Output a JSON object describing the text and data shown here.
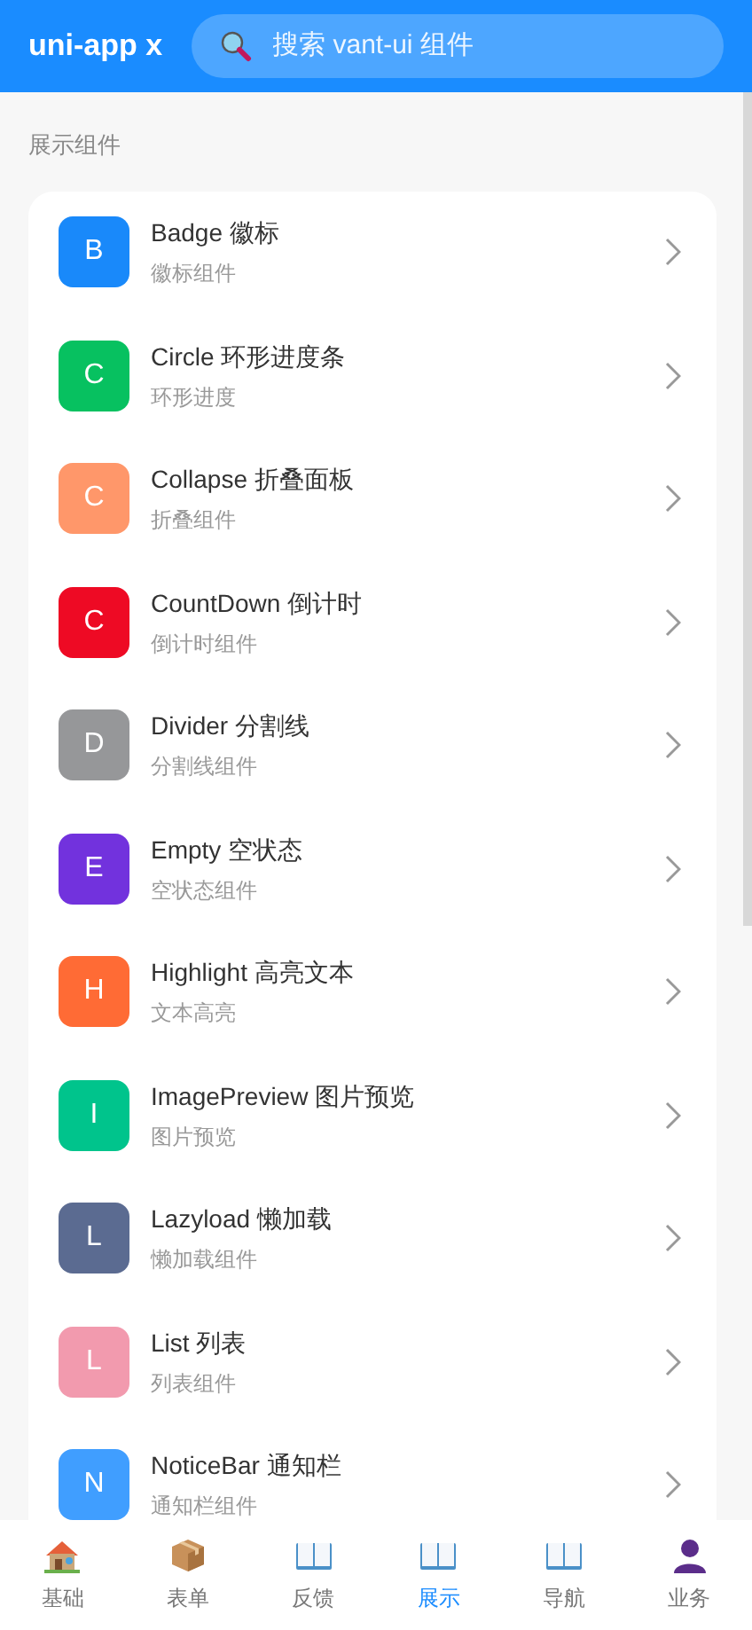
{
  "header": {
    "title": "uni-app x",
    "search": {
      "placeholder": "搜索 vant-ui 组件"
    }
  },
  "section": {
    "title": "展示组件"
  },
  "items": [
    {
      "letter": "B",
      "title": "Badge 徽标",
      "subtitle": "徽标组件",
      "color": "#1989fa"
    },
    {
      "letter": "C",
      "title": "Circle 环形进度条",
      "subtitle": "环形进度",
      "color": "#07c160"
    },
    {
      "letter": "C",
      "title": "Collapse 折叠面板",
      "subtitle": "折叠组件",
      "color": "#ff976a"
    },
    {
      "letter": "C",
      "title": "CountDown 倒计时",
      "subtitle": "倒计时组件",
      "color": "#ee0a24"
    },
    {
      "letter": "D",
      "title": "Divider 分割线",
      "subtitle": "分割线组件",
      "color": "#969799"
    },
    {
      "letter": "E",
      "title": "Empty 空状态",
      "subtitle": "空状态组件",
      "color": "#7232dd"
    },
    {
      "letter": "H",
      "title": "Highlight 高亮文本",
      "subtitle": "文本高亮",
      "color": "#ff6b35"
    },
    {
      "letter": "I",
      "title": "ImagePreview 图片预览",
      "subtitle": "图片预览",
      "color": "#00c48c"
    },
    {
      "letter": "L",
      "title": "Lazyload 懒加载",
      "subtitle": "懒加载组件",
      "color": "#5b6b91"
    },
    {
      "letter": "L",
      "title": "List 列表",
      "subtitle": "列表组件",
      "color": "#f29aae"
    },
    {
      "letter": "N",
      "title": "NoticeBar 通知栏",
      "subtitle": "通知栏组件",
      "color": "#409eff"
    }
  ],
  "tabs": [
    {
      "label": "基础",
      "kind": "house",
      "selected": false
    },
    {
      "label": "表单",
      "kind": "box",
      "selected": false
    },
    {
      "label": "反馈",
      "kind": "book",
      "selected": false
    },
    {
      "label": "展示",
      "kind": "book",
      "selected": true
    },
    {
      "label": "导航",
      "kind": "book",
      "selected": false
    },
    {
      "label": "业务",
      "kind": "person",
      "selected": false
    }
  ]
}
